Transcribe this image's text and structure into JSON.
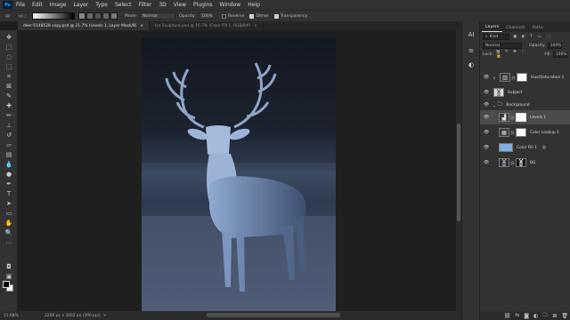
{
  "menubar": {
    "app_icon": "Ps",
    "items": [
      "File",
      "Edit",
      "Image",
      "Layer",
      "Type",
      "Select",
      "Filter",
      "3D",
      "View",
      "Plugins",
      "Window",
      "Help"
    ]
  },
  "options": {
    "mode_label": "Mode:",
    "mode_value": "Normal",
    "opacity_label": "Opacity:",
    "opacity_value": "100%",
    "reverse_label": "Reverse",
    "dither_label": "Dither",
    "transparency_label": "Transparency"
  },
  "tabs": [
    {
      "label": "deer-5148528 copy.psd @ 21.7% (Levels 1, Layer Mask/8)",
      "close": "×"
    },
    {
      "label": "Ice Sculpture.psd @ 16.7% (Color Fill 1, RGB/8#)",
      "close": "×"
    }
  ],
  "status": {
    "zoom": "21.68%",
    "dimensions": "2268 px x 3402 px (300 ppi)",
    "arrow": ">"
  },
  "panel": {
    "tabs": [
      "Layers",
      "Channels",
      "Paths"
    ],
    "filter_label": "Kind",
    "blend_mode": "Normal",
    "opacity_label": "Opacity:",
    "opacity_value": "100%",
    "lock_label": "Lock:",
    "fill_label": "Fill:",
    "fill_value": "100%",
    "layers": [
      {
        "name": "Hue/Saturation 1",
        "type": "adjustment"
      },
      {
        "name": "Subject",
        "type": "image"
      },
      {
        "name": "Background",
        "type": "group"
      },
      {
        "name": "Levels 1",
        "type": "adjustment"
      },
      {
        "name": "Color Lookup 1",
        "type": "adjustment"
      },
      {
        "name": "Color Fill 1",
        "type": "fill"
      },
      {
        "name": "BG",
        "type": "image"
      }
    ],
    "bottom_icons": [
      "link-icon",
      "fx-icon",
      "mask-icon",
      "adjustment-icon",
      "folder-icon",
      "new-layer-icon",
      "trash-icon"
    ]
  },
  "colors": {
    "ui_dark": "#323232",
    "canvas_bg": "#1f1f1f",
    "fill_swatch": "#7fb0e0",
    "selected_layer": "#4b4b4b"
  }
}
